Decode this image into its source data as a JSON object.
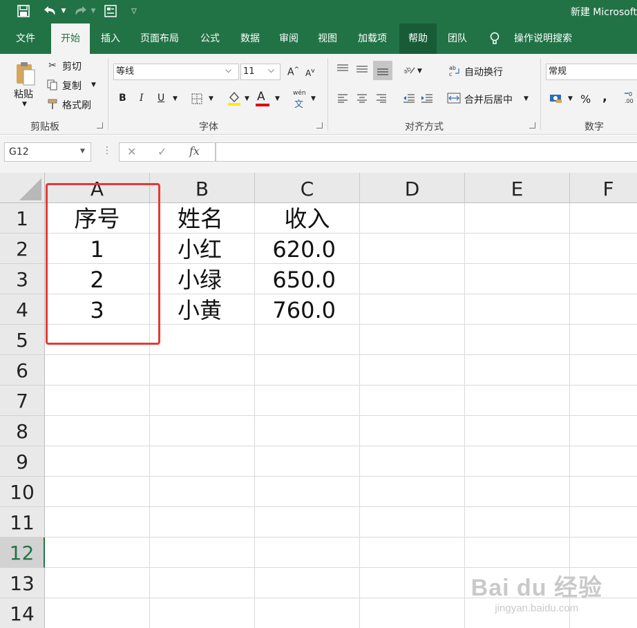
{
  "title": "新建 Microsoft",
  "quick_access": {
    "save": "save-icon",
    "undo": "undo-icon",
    "redo": "redo-icon",
    "form": "form-icon",
    "customize": "customize-icon"
  },
  "tabs": [
    "文件",
    "开始",
    "插入",
    "页面布局",
    "公式",
    "数据",
    "审阅",
    "视图",
    "加载项",
    "帮助",
    "团队"
  ],
  "tell_me": "操作说明搜索",
  "ribbon": {
    "clipboard": {
      "paste": "粘贴",
      "cut": "剪切",
      "copy": "复制",
      "format_painter": "格式刷",
      "label": "剪贴板"
    },
    "font": {
      "name": "等线",
      "size": "11",
      "bold": "B",
      "italic": "I",
      "underline": "U",
      "font_color": "A",
      "phonetic": "wén",
      "phonetic_char": "文",
      "label": "字体"
    },
    "alignment": {
      "wrap": "自动换行",
      "merge": "合并后居中",
      "label": "对齐方式"
    },
    "number": {
      "format": "常规",
      "percent": "%",
      "comma": ",",
      "label": "数字"
    }
  },
  "formula_bar": {
    "name_box": "G12",
    "cancel": "✕",
    "enter": "✓",
    "fx": "fx",
    "value": ""
  },
  "columns": [
    "A",
    "B",
    "C",
    "D",
    "E",
    "F"
  ],
  "rows": [
    "1",
    "2",
    "3",
    "4",
    "5",
    "6",
    "7",
    "8",
    "9",
    "10",
    "11",
    "12",
    "13",
    "14"
  ],
  "selected_row": "12",
  "cells": [
    [
      "序号",
      "姓名",
      "收入"
    ],
    [
      "1",
      "小红",
      "620.0"
    ],
    [
      "2",
      "小绿",
      "650.0"
    ],
    [
      "3",
      "小黄",
      "760.0"
    ]
  ],
  "watermark": {
    "main": "Bai du 经验",
    "url": "jingyan.baidu.com"
  },
  "colors": {
    "excel_green": "#217346",
    "highlight_border": "#e53935"
  }
}
